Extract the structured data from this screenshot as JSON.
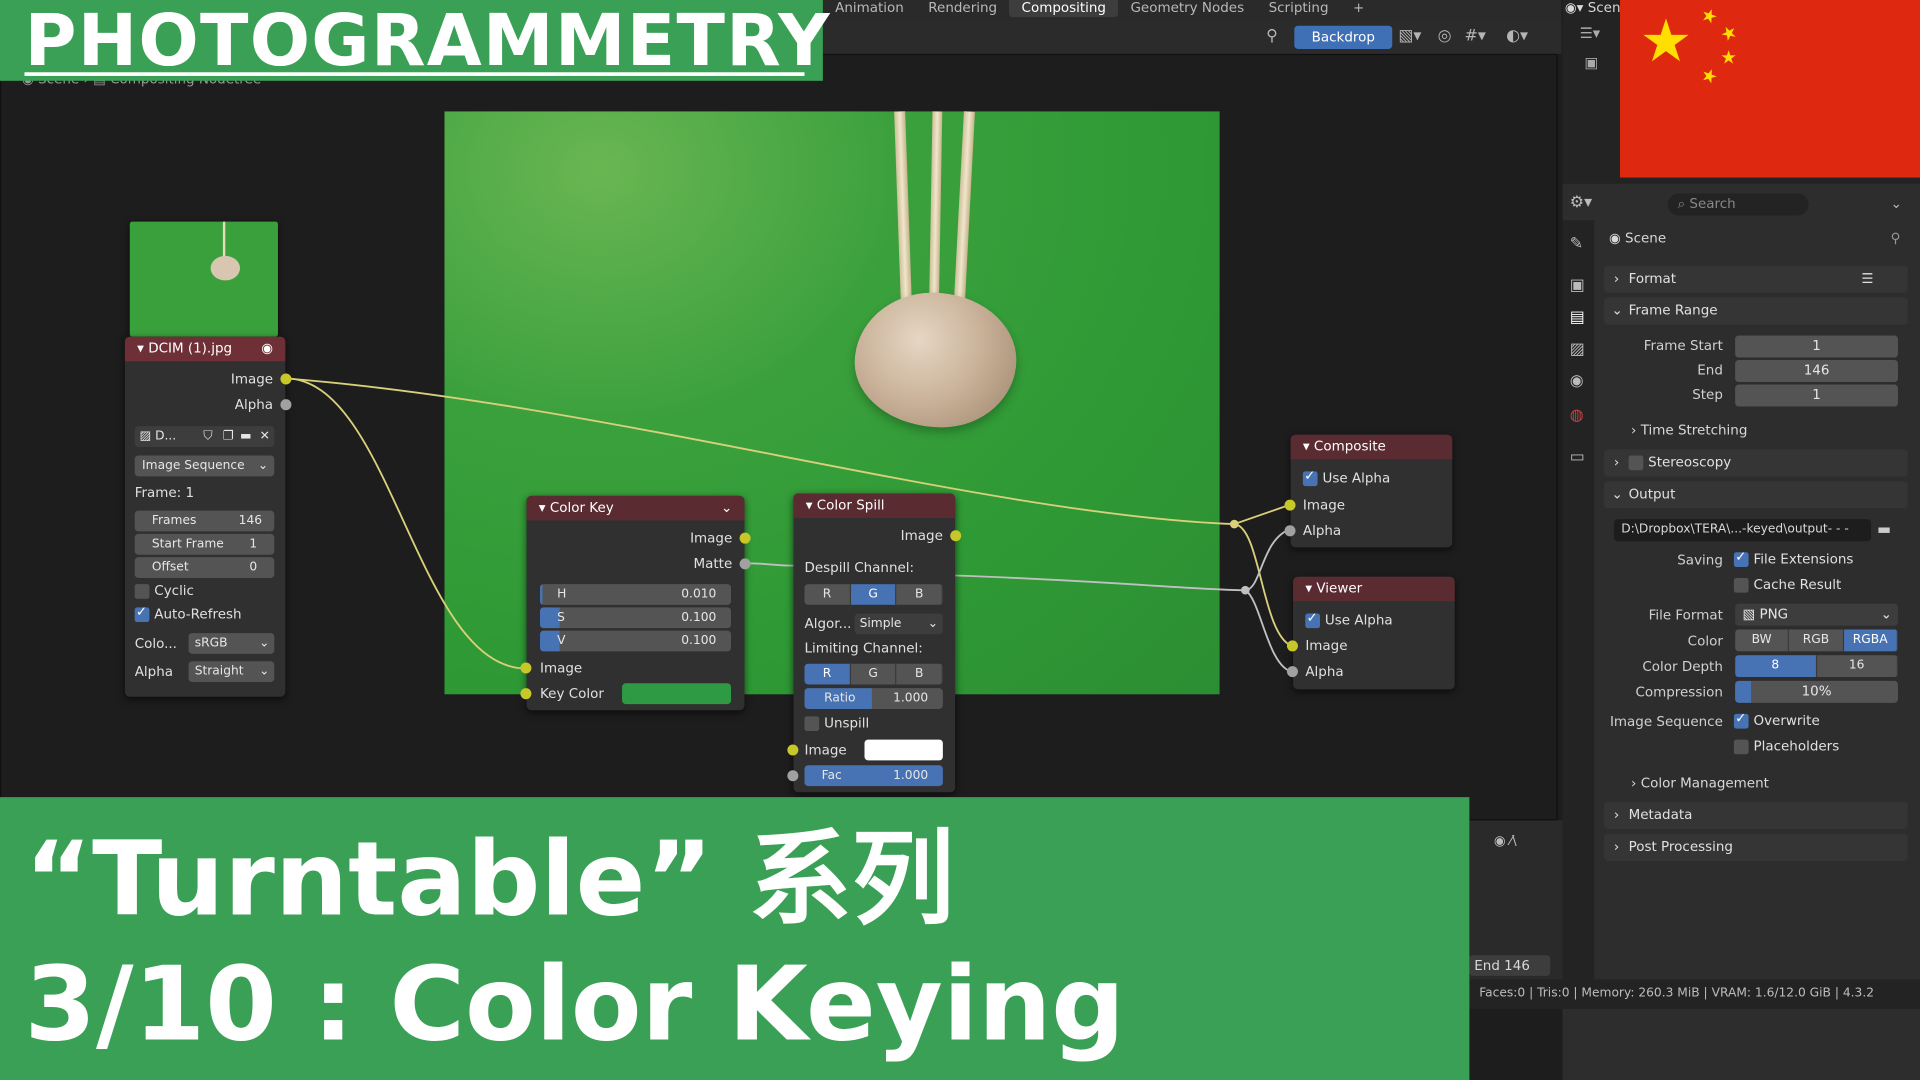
{
  "workspace_tabs": [
    {
      "label": "Animation",
      "active": false
    },
    {
      "label": "Rendering",
      "active": false
    },
    {
      "label": "Compositing",
      "active": true
    },
    {
      "label": "Geometry Nodes",
      "active": false
    },
    {
      "label": "Scripting",
      "active": false
    },
    {
      "label": "+",
      "active": false
    }
  ],
  "header": {
    "backdrop_label": "Backdrop",
    "scene_label": "Scene"
  },
  "breadcrumb": {
    "scene": "Scene",
    "tree": "Compositing Nodetree"
  },
  "image_node": {
    "title": "DCIM (1).jpg",
    "out_image": "Image",
    "out_alpha": "Alpha",
    "image_name": "D...",
    "source": "Image Sequence",
    "frame_label": "Frame: 1",
    "frames_label": "Frames",
    "frames_value": "146",
    "start_label": "Start Frame",
    "start_value": "1",
    "offset_label": "Offset",
    "offset_value": "0",
    "cyclic": "Cyclic",
    "auto_refresh": "Auto-Refresh",
    "colorspace_label": "Colo...",
    "colorspace_value": "sRGB",
    "alpha_label": "Alpha",
    "alpha_value": "Straight"
  },
  "color_key": {
    "title": "Color Key",
    "out_image": "Image",
    "out_matte": "Matte",
    "h_label": "H",
    "h_value": "0.010",
    "h_fill": 0.01,
    "s_label": "S",
    "s_value": "0.100",
    "s_fill": 0.1,
    "v_label": "V",
    "v_value": "0.100",
    "v_fill": 0.1,
    "in_image": "Image",
    "in_key": "Key Color",
    "key_color": "#2f9a44"
  },
  "color_spill": {
    "title": "Color Spill",
    "out_image": "Image",
    "despill_label": "Despill Channel:",
    "despill": [
      "R",
      "G",
      "B"
    ],
    "despill_active": 1,
    "algo_label": "Algor...",
    "algo_value": "Simple",
    "limit_label": "Limiting Channel:",
    "limit": [
      "R",
      "G",
      "B"
    ],
    "limit_active": 0,
    "ratio_label": "Ratio",
    "ratio_value": "1.000",
    "unspill": "Unspill",
    "in_image": "Image",
    "fac_label": "Fac",
    "fac_value": "1.000"
  },
  "composite": {
    "title": "Composite",
    "use_alpha": "Use Alpha",
    "in_image": "Image",
    "in_alpha": "Alpha"
  },
  "viewer": {
    "title": "Viewer",
    "use_alpha": "Use Alpha",
    "in_image": "Image",
    "in_alpha": "Alpha"
  },
  "props": {
    "search_placeholder": "Search",
    "scene": "Scene",
    "format": "Format",
    "frame_range": "Frame Range",
    "frame_start_label": "Frame Start",
    "frame_start": "1",
    "end_label": "End",
    "end": "146",
    "step_label": "Step",
    "step": "1",
    "time_stretching": "Time Stretching",
    "stereoscopy": "Stereoscopy",
    "output": "Output",
    "output_path": "D:\\Dropbox\\TERA\\...-keyed\\output- - -",
    "saving_label": "Saving",
    "file_ext": "File Extensions",
    "cache_result": "Cache Result",
    "file_format_label": "File Format",
    "file_format": "PNG",
    "color_label": "Color",
    "color_modes": [
      "BW",
      "RGB",
      "RGBA"
    ],
    "color_active": 2,
    "depth_label": "Color Depth",
    "depths": [
      "8",
      "16"
    ],
    "depth_active": 0,
    "compression_label": "Compression",
    "compression": "10%",
    "compression_fill": 0.1,
    "imgseq_label": "Image Sequence",
    "overwrite": "Overwrite",
    "placeholders": "Placeholders",
    "color_management": "Color Management",
    "metadata": "Metadata",
    "post_processing": "Post Processing"
  },
  "timeline": {
    "end_label": "End",
    "end_value": "146"
  },
  "statusbar": "Faces:0 | Tris:0 | Memory: 260.3 MiB | VRAM: 1.6/12.0 GiB | 4.3.2",
  "overlay": {
    "title": "PHOTOGRAMMETRY",
    "line1": "“Turntable” 系列",
    "line2": "3/10 : Color Keying"
  },
  "colors": {
    "accent_green": "#3aa056",
    "select_blue": "#4772b3",
    "flag_red": "#de2910",
    "flag_star": "#ffde00"
  }
}
